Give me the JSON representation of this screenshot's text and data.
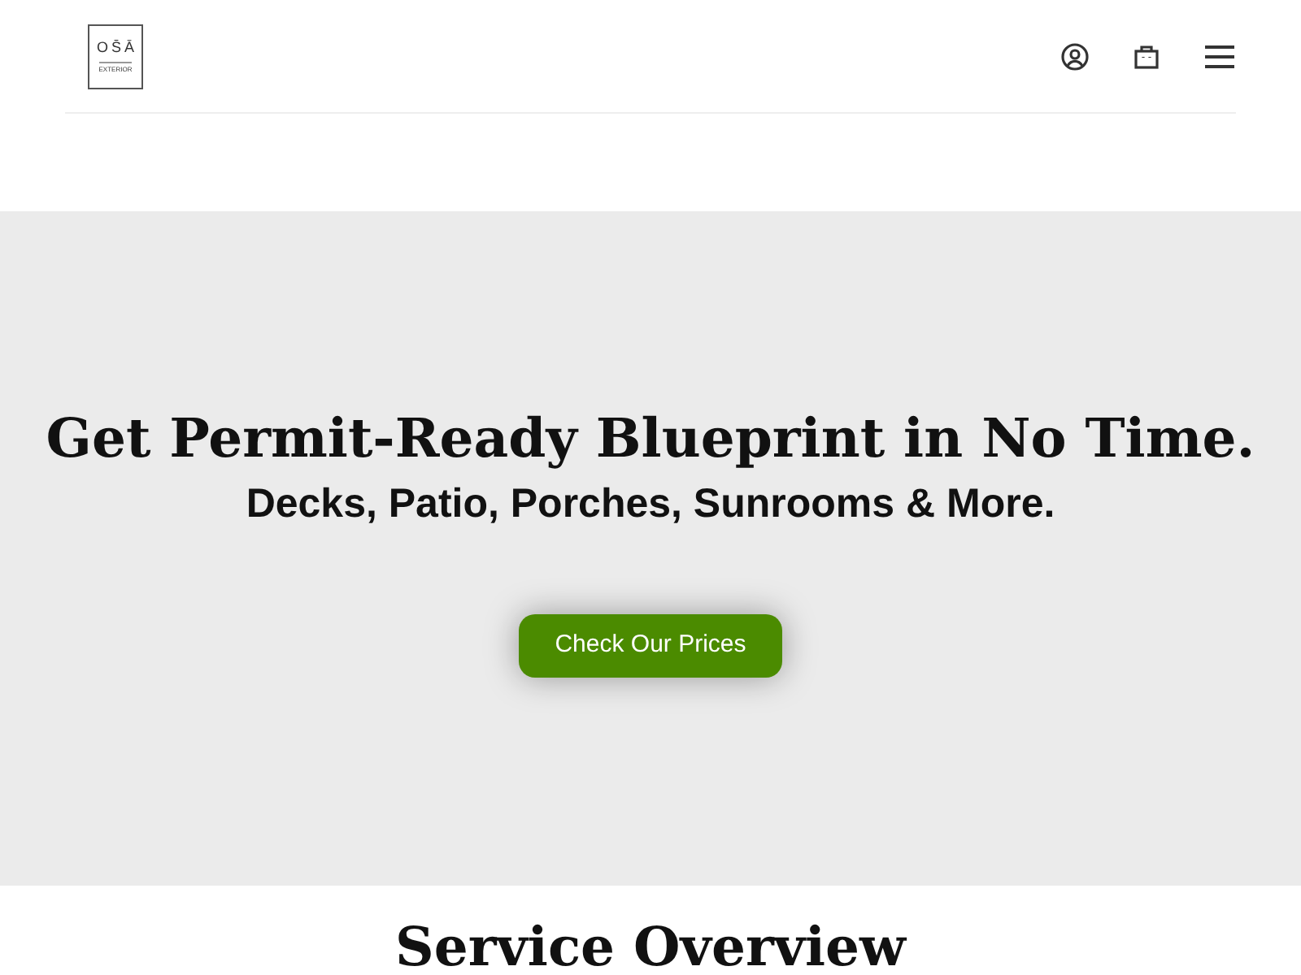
{
  "logo": {
    "letters": [
      "O",
      "S̄",
      "Ā"
    ],
    "tagline": "EXTERIOR"
  },
  "hero": {
    "title": "Get Permit-Ready Blueprint in No Time.",
    "subtitle": "Decks, Patio, Porches, Sunrooms & More.",
    "button": "Check Our Prices"
  },
  "section": {
    "title": "Service Overview"
  }
}
